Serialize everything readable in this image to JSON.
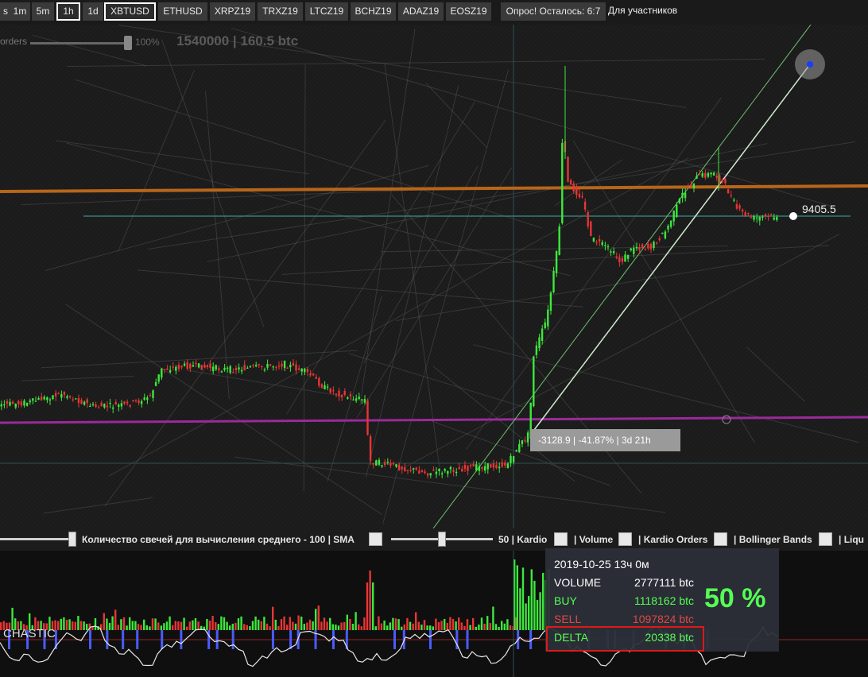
{
  "toolbar": {
    "timeframes": [
      "s",
      "1m",
      "5m",
      "1h",
      "1d"
    ],
    "selected_timeframe": "1h",
    "symbols": [
      "XBTUSD",
      "ETHUSD",
      "XRPZ19",
      "TRXZ19",
      "LTCZ19",
      "BCHZ19",
      "ADAZ19",
      "EOSZ19"
    ],
    "selected_symbol": "XBTUSD",
    "survey_button": "Опрос! Осталось: 6:7",
    "survey_label": "Для участников"
  },
  "chart": {
    "orders_label": "orders",
    "orders_percent": "100%",
    "orders_level": 1.0,
    "header": "1540000 | 160.5 btc",
    "last_price": "9405.5",
    "measure_tip": "-3128.9 | -41.87% | 3d 21h",
    "colors": {
      "background": "#1a1a1a",
      "up_candle": "#3de83d",
      "down_candle": "#e83535",
      "resistance_line": "#b8651a",
      "support_line": "#9a2a9a",
      "price_line": "#3c8c8c",
      "trend_line": "#a8e8a8"
    }
  },
  "settings_bar": {
    "sma_label": "Количество свечей для вычисления среднего - 100 | SMA",
    "kardio_label": "50 | Kardio",
    "volume_label": "| Volume",
    "kardio_orders_label": "| Kardio Orders",
    "bollinger_label": "| Bollinger Bands",
    "liquid_label": "| Liqu"
  },
  "volume_pane": {
    "indicator_label": "CHASTIC"
  },
  "info_box": {
    "date": "2019-10-25 13ч 0м",
    "rows": [
      {
        "key": "VOLUME",
        "value": "2777111 btc",
        "color": "#ffffff"
      },
      {
        "key": "BUY",
        "value": "1118162 btc",
        "color": "#54ff54"
      },
      {
        "key": "SELL",
        "value": "1097824 btc",
        "color": "#e04848"
      },
      {
        "key": "DELTA",
        "value": "20338 btc",
        "color": "#54ff54"
      }
    ],
    "percent": "50 %"
  }
}
